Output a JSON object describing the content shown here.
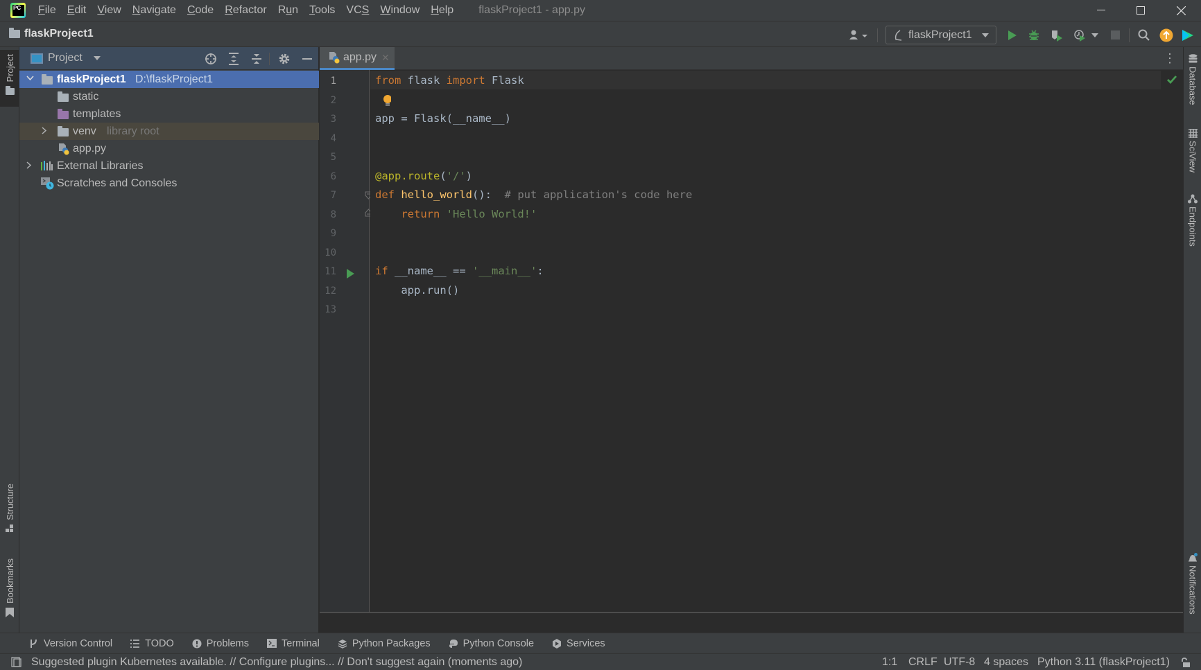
{
  "titlebar": {
    "menu": [
      {
        "label": "File",
        "mnemonic_index": 0
      },
      {
        "label": "Edit",
        "mnemonic_index": 0
      },
      {
        "label": "View",
        "mnemonic_index": 0
      },
      {
        "label": "Navigate",
        "mnemonic_index": 0
      },
      {
        "label": "Code",
        "mnemonic_index": 0
      },
      {
        "label": "Refactor",
        "mnemonic_index": 0
      },
      {
        "label": "Run",
        "mnemonic_index": 1
      },
      {
        "label": "Tools",
        "mnemonic_index": 0
      },
      {
        "label": "VCS",
        "mnemonic_index": 2
      },
      {
        "label": "Window",
        "mnemonic_index": 0
      },
      {
        "label": "Help",
        "mnemonic_index": 0
      }
    ],
    "window_title": "flaskProject1 - app.py",
    "controls": {
      "minimize": "minimize-icon",
      "maximize": "maximize-icon",
      "close": "close-icon"
    }
  },
  "navbar": {
    "breadcrumb": "flaskProject1",
    "run_config": "flaskProject1",
    "icons": [
      "user-icon",
      "run-icon",
      "debug-icon",
      "coverage-icon",
      "profile-icon",
      "stop-icon",
      "search-icon",
      "update-icon",
      "jetbrains-toolbox-icon"
    ]
  },
  "left_strip": {
    "tabs": [
      "Project",
      "Structure",
      "Bookmarks"
    ]
  },
  "project_panel": {
    "title": "Project",
    "header_icons": [
      "locate-icon",
      "expand-all-icon",
      "collapse-all-icon",
      "gear-icon",
      "hide-icon"
    ],
    "tree": [
      {
        "label": "flaskProject1",
        "hint": "D:\\flaskProject1",
        "type": "folder",
        "expanded": true,
        "selected": true,
        "depth": 0
      },
      {
        "label": "static",
        "type": "folder",
        "depth": 1
      },
      {
        "label": "templates",
        "type": "templates-folder",
        "depth": 1
      },
      {
        "label": "venv",
        "hint": "library root",
        "type": "folder",
        "expanded": false,
        "depth": 1
      },
      {
        "label": "app.py",
        "type": "python-file",
        "depth": 1
      },
      {
        "label": "External Libraries",
        "type": "libraries",
        "expanded": false,
        "depth": 0
      },
      {
        "label": "Scratches and Consoles",
        "type": "scratches",
        "depth": 0
      }
    ]
  },
  "editor": {
    "tabs": [
      {
        "label": "app.py",
        "active": true
      }
    ],
    "line_count": 13,
    "current_line": 1,
    "code": [
      "from flask import Flask",
      "",
      "app = Flask(__name__)",
      "",
      "",
      "@app.route('/')",
      "def hello_world():  # put application's code here",
      "    return 'Hello World!'",
      "",
      "",
      "if __name__ == '__main__':",
      "    app.run()",
      ""
    ],
    "inspection_status": "no-problems"
  },
  "right_strip": {
    "tabs": [
      "Database",
      "SciView",
      "Endpoints",
      "Notifications"
    ]
  },
  "bottom_tools": [
    {
      "label": "Version Control",
      "icon": "version-control-icon"
    },
    {
      "label": "TODO",
      "icon": "todo-icon"
    },
    {
      "label": "Problems",
      "icon": "problems-icon"
    },
    {
      "label": "Terminal",
      "icon": "terminal-icon"
    },
    {
      "label": "Python Packages",
      "icon": "python-packages-icon"
    },
    {
      "label": "Python Console",
      "icon": "python-console-icon"
    },
    {
      "label": "Services",
      "icon": "services-icon"
    }
  ],
  "status_bar": {
    "message": "Suggested plugin Kubernetes available. // Configure plugins... // Don't suggest again (moments ago)",
    "caret": "1:1",
    "line_separator": "CRLF",
    "encoding": "UTF-8",
    "indent": "4 spaces",
    "interpreter": "Python 3.11 (flaskProject1)"
  },
  "colors": {
    "selection": "#4b6eaf",
    "library_root_bg": "#4a473e",
    "run_green": "#499c54",
    "keyword": "#cc7832",
    "string": "#6a8759",
    "decorator": "#bbb529",
    "function": "#ffc66d"
  }
}
